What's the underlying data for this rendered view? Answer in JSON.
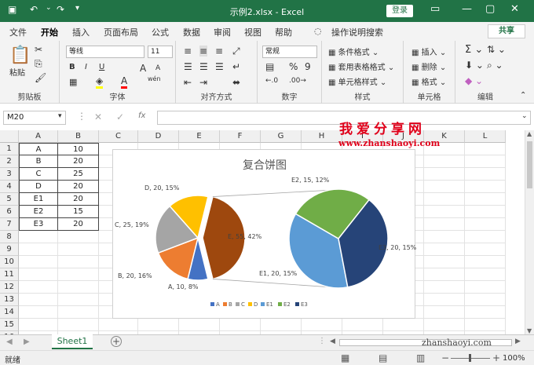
{
  "window": {
    "title": "示例2.xlsx  -  Excel",
    "login": "登录"
  },
  "tabs": [
    "文件",
    "开始",
    "插入",
    "页面布局",
    "公式",
    "数据",
    "审阅",
    "视图",
    "帮助",
    "操作说明搜索"
  ],
  "share": "共享",
  "ribbon": {
    "clipboard": {
      "paste": "粘贴",
      "label": "剪贴板"
    },
    "font": {
      "name": "等线",
      "size": "11",
      "label": "字体",
      "bold": "B",
      "italic": "I",
      "underline": "U",
      "grow": "A",
      "shrink": "A"
    },
    "alignment": {
      "label": "对齐方式"
    },
    "number": {
      "format": "常规",
      "label": "数字",
      "percent": "%",
      "comma": "9"
    },
    "styles": {
      "cond": "条件格式",
      "table": "套用表格格式",
      "cell": "单元格样式",
      "label": "样式"
    },
    "cells": {
      "insert": "插入",
      "delete": "删除",
      "format": "格式",
      "label": "单元格"
    },
    "editing": {
      "label": "编辑"
    }
  },
  "formula": {
    "namebox": "M20",
    "fx": "fx",
    "content": ""
  },
  "columns": [
    "A",
    "B",
    "C",
    "D",
    "E",
    "F",
    "G",
    "H",
    "I",
    "J",
    "K",
    "L"
  ],
  "rows": [
    "1",
    "2",
    "3",
    "4",
    "5",
    "6",
    "7",
    "8",
    "9",
    "10",
    "11",
    "12",
    "13",
    "14",
    "15",
    "16"
  ],
  "table": [
    [
      "A",
      "10"
    ],
    [
      "B",
      "20"
    ],
    [
      "C",
      "25"
    ],
    [
      "D",
      "20"
    ],
    [
      "E1",
      "20"
    ],
    [
      "E2",
      "15"
    ],
    [
      "E3",
      "20"
    ]
  ],
  "chart_data": {
    "type": "pie",
    "title": "复合饼图",
    "categories": [
      "A",
      "B",
      "C",
      "D",
      "E1",
      "E2",
      "E3"
    ],
    "primary": [
      {
        "name": "A",
        "value": 10,
        "pct": "8%"
      },
      {
        "name": "B",
        "value": 20,
        "pct": "16%"
      },
      {
        "name": "C",
        "value": 25,
        "pct": "19%"
      },
      {
        "name": "D",
        "value": 20,
        "pct": "15%"
      },
      {
        "name": "E",
        "value": 55,
        "pct": "42%"
      }
    ],
    "secondary": [
      {
        "name": "E1",
        "value": 20,
        "pct": "15%"
      },
      {
        "name": "E2",
        "value": 15,
        "pct": "12%"
      },
      {
        "name": "E3",
        "value": 20,
        "pct": "15%"
      }
    ],
    "colors": {
      "A": "#4472c4",
      "B": "#ed7d31",
      "C": "#a5a5a5",
      "D": "#ffc000",
      "E": "#9e480e",
      "E1": "#5b9bd5",
      "E2": "#70ad47",
      "E3": "#264478"
    },
    "legend": "bottom"
  },
  "labels": {
    "A": "A, 10, 8%",
    "B": "B, 20, 16%",
    "C": "C, 25, 19%",
    "D": "D, 20, 15%",
    "E": "E, 55, 42%",
    "E1": "E1, 20, 15%",
    "E2": "E2, 15, 12%",
    "E3": "E3, 20, 15%"
  },
  "legend_items": [
    "A",
    "B",
    "C",
    "D",
    "E1",
    "E2",
    "E3"
  ],
  "sheet": {
    "name": "Sheet1",
    "add": "+"
  },
  "status": {
    "ready": "就绪",
    "zoom": "100%"
  },
  "watermark": {
    "title": "我爱分享网",
    "url": "www.zhanshaoyi.com",
    "url2": "zhanshaoyi.com"
  }
}
